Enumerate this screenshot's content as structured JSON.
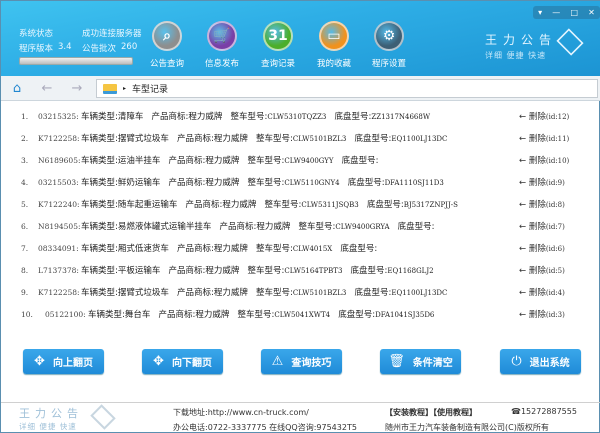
{
  "header": {
    "status_label": "系统状态",
    "status_value": "成功连接服务器",
    "version_label": "程序版本",
    "version_value": "3.4",
    "batch_label": "公告批次",
    "batch_value": "260",
    "progress": 1.0,
    "nav": [
      {
        "label": "公告查询",
        "icon": "search-badge-icon",
        "color": "#8e8e8e"
      },
      {
        "label": "信息发布",
        "icon": "cart-icon",
        "color": "#7a3fa6"
      },
      {
        "label": "查询记录",
        "icon": "calendar-icon",
        "color": "#4cae2a"
      },
      {
        "label": "我的收藏",
        "icon": "folder-icon",
        "color": "#f0921e"
      },
      {
        "label": "程序设置",
        "icon": "gear-icon",
        "color": "#3d5f75"
      }
    ],
    "brand_title": "王力公告",
    "brand_sub": "详细 便捷 快速"
  },
  "address": {
    "path": "车型记录"
  },
  "labels": {
    "type": "车辆类型:",
    "brand": "产品商标:",
    "model": "整车型号:",
    "chassis": "底盘型号:",
    "delete": "删除"
  },
  "records": [
    {
      "n": "1.",
      "id": "03215325:",
      "type": "清障车",
      "brand": "程力威牌",
      "model": "CLW5310TQZZ3",
      "chassis": "ZZ1317N4668W",
      "gid": "(id:12)"
    },
    {
      "n": "2.",
      "id": "K7122258:",
      "type": "摆臂式垃圾车",
      "brand": "程力威牌",
      "model": "CLW5101BZL3",
      "chassis": "EQ1100LJ13DC",
      "gid": "(id:11)"
    },
    {
      "n": "3.",
      "id": "N6189605:",
      "type": "运油半挂车",
      "brand": "程力威牌",
      "model": "CLW9400GYY",
      "chassis": "",
      "gid": "(id:10)"
    },
    {
      "n": "4.",
      "id": "03215503:",
      "type": "鲜奶运输车",
      "brand": "程力威牌",
      "model": "CLW5110GNY4",
      "chassis": "DFA1110SJ11D3",
      "gid": "(id:9)"
    },
    {
      "n": "5.",
      "id": "K7122240:",
      "type": "随车起重运输车",
      "brand": "程力威牌",
      "model": "CLW5311JSQB3",
      "chassis": "BJ5317ZNPJJ-S",
      "gid": "(id:8)"
    },
    {
      "n": "6.",
      "id": "N8194505:",
      "type": "易燃液体罐式运输半挂车",
      "brand": "程力威牌",
      "model": "CLW9400GRYA",
      "chassis": "",
      "gid": "(id:7)"
    },
    {
      "n": "7.",
      "id": "08334091:",
      "type": "厢式低速货车",
      "brand": "程力威牌",
      "model": "CLW4015X",
      "chassis": "",
      "gid": "(id:6)"
    },
    {
      "n": "8.",
      "id": "L7137378:",
      "type": "平板运输车",
      "brand": "程力威牌",
      "model": "CLW5164TPBT3",
      "chassis": "EQ1168GLJ2",
      "gid": "(id:5)"
    },
    {
      "n": "9.",
      "id": "K7122258:",
      "type": "摆臂式垃圾车",
      "brand": "程力威牌",
      "model": "CLW5101BZL3",
      "chassis": "EQ1100LJ13DC",
      "gid": "(id:4)"
    },
    {
      "n": "10.",
      "id": "05122100:",
      "type": "舞台车",
      "brand": "程力威牌",
      "model": "CLW5041XWT4",
      "chassis": "DFA1041SJ35D6",
      "gid": "(id:3)"
    }
  ],
  "buttons": [
    {
      "label": "向上翻页",
      "icon": "move-icon"
    },
    {
      "label": "向下翻页",
      "icon": "move-icon"
    },
    {
      "label": "查询技巧",
      "icon": "warning-icon"
    },
    {
      "label": "条件清空",
      "icon": "trash-icon"
    },
    {
      "label": "退出系统",
      "icon": "power-icon"
    }
  ],
  "footer": {
    "brand_title": "王力公告",
    "brand_sub": "详细 便捷 快速",
    "download": "下载地址:http://www.cn-truck.com/",
    "phone": "办公电话:0722-3337775 在线QQ咨询:975432T5",
    "links": "【安装教程】【使用教程】",
    "tel": "☎15272887555",
    "copyright": "随州市王力汽车装备制造有限公司(C)版权所有"
  }
}
